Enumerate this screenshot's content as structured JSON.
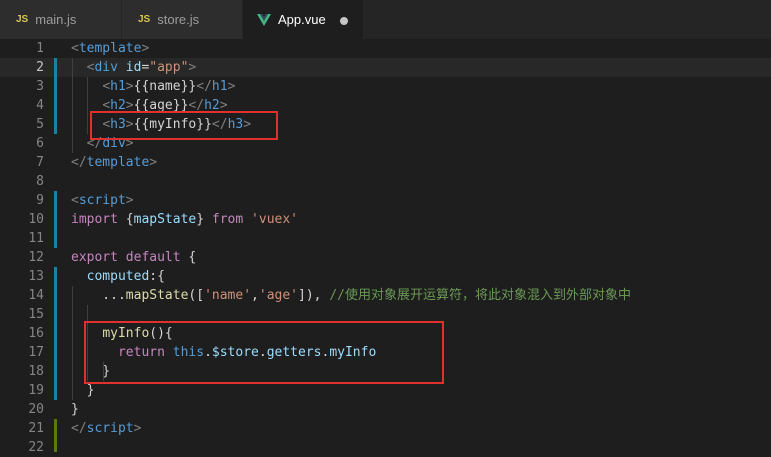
{
  "tabs": [
    {
      "label": "main.js",
      "icon": "JS"
    },
    {
      "label": "store.js",
      "icon": "JS"
    },
    {
      "label": "App.vue",
      "icon": "vue"
    }
  ],
  "lines": [
    {
      "n": "1",
      "tokens": [
        [
          "punc",
          "<"
        ],
        [
          "tag",
          "template"
        ],
        [
          "punc",
          ">"
        ]
      ]
    },
    {
      "n": "2",
      "tokens": [
        [
          "text",
          "  "
        ],
        [
          "punc",
          "<"
        ],
        [
          "tag",
          "div"
        ],
        [
          "text",
          " "
        ],
        [
          "attr",
          "id"
        ],
        [
          "text",
          "="
        ],
        [
          "str",
          "\"app\""
        ],
        [
          "punc",
          ">"
        ]
      ]
    },
    {
      "n": "3",
      "tokens": [
        [
          "text",
          "    "
        ],
        [
          "punc",
          "<"
        ],
        [
          "tag",
          "h1"
        ],
        [
          "punc",
          ">"
        ],
        [
          "text",
          "{{name}}"
        ],
        [
          "punc",
          "</"
        ],
        [
          "tag",
          "h1"
        ],
        [
          "punc",
          ">"
        ]
      ]
    },
    {
      "n": "4",
      "tokens": [
        [
          "text",
          "    "
        ],
        [
          "punc",
          "<"
        ],
        [
          "tag",
          "h2"
        ],
        [
          "punc",
          ">"
        ],
        [
          "text",
          "{{age}}"
        ],
        [
          "punc",
          "</"
        ],
        [
          "tag",
          "h2"
        ],
        [
          "punc",
          ">"
        ]
      ]
    },
    {
      "n": "5",
      "tokens": [
        [
          "text",
          "    "
        ],
        [
          "punc",
          "<"
        ],
        [
          "tag",
          "h3"
        ],
        [
          "punc",
          ">"
        ],
        [
          "text",
          "{{myInfo}}"
        ],
        [
          "punc",
          "</"
        ],
        [
          "tag",
          "h3"
        ],
        [
          "punc",
          ">"
        ]
      ]
    },
    {
      "n": "6",
      "tokens": [
        [
          "text",
          "  "
        ],
        [
          "punc",
          "</"
        ],
        [
          "tag",
          "div"
        ],
        [
          "punc",
          ">"
        ]
      ]
    },
    {
      "n": "7",
      "tokens": [
        [
          "punc",
          "</"
        ],
        [
          "tag",
          "template"
        ],
        [
          "punc",
          ">"
        ]
      ]
    },
    {
      "n": "8",
      "tokens": []
    },
    {
      "n": "9",
      "tokens": [
        [
          "punc",
          "<"
        ],
        [
          "tag",
          "script"
        ],
        [
          "punc",
          ">"
        ]
      ]
    },
    {
      "n": "10",
      "tokens": [
        [
          "kw",
          "import"
        ],
        [
          "text",
          " {"
        ],
        [
          "var",
          "mapState"
        ],
        [
          "text",
          "} "
        ],
        [
          "kw",
          "from"
        ],
        [
          "text",
          " "
        ],
        [
          "str",
          "'vuex'"
        ]
      ]
    },
    {
      "n": "11",
      "tokens": []
    },
    {
      "n": "12",
      "tokens": [
        [
          "kw",
          "export"
        ],
        [
          "text",
          " "
        ],
        [
          "kw",
          "default"
        ],
        [
          "text",
          " {"
        ]
      ]
    },
    {
      "n": "13",
      "tokens": [
        [
          "text",
          "  "
        ],
        [
          "var",
          "computed"
        ],
        [
          "text",
          ":{"
        ]
      ]
    },
    {
      "n": "14",
      "tokens": [
        [
          "text",
          "    ..."
        ],
        [
          "fn",
          "mapState"
        ],
        [
          "text",
          "(["
        ],
        [
          "str",
          "'name'"
        ],
        [
          "text",
          ","
        ],
        [
          "str",
          "'age'"
        ],
        [
          "text",
          "]), "
        ],
        [
          "cmt",
          "//使用对象展开运算符，将此对象混入到外部对象中"
        ]
      ]
    },
    {
      "n": "15",
      "tokens": []
    },
    {
      "n": "16",
      "tokens": [
        [
          "text",
          "    "
        ],
        [
          "fn",
          "myInfo"
        ],
        [
          "text",
          "(){"
        ]
      ]
    },
    {
      "n": "17",
      "tokens": [
        [
          "text",
          "      "
        ],
        [
          "kw",
          "return"
        ],
        [
          "text",
          " "
        ],
        [
          "blue",
          "this"
        ],
        [
          "text",
          "."
        ],
        [
          "var",
          "$store"
        ],
        [
          "text",
          "."
        ],
        [
          "var",
          "getters"
        ],
        [
          "text",
          "."
        ],
        [
          "var",
          "myInfo"
        ]
      ]
    },
    {
      "n": "18",
      "tokens": [
        [
          "text",
          "    }"
        ]
      ]
    },
    {
      "n": "19",
      "tokens": [
        [
          "text",
          "  }"
        ]
      ]
    },
    {
      "n": "20",
      "tokens": [
        [
          "text",
          "}"
        ]
      ]
    },
    {
      "n": "21",
      "tokens": [
        [
          "punc",
          "</"
        ],
        [
          "tag",
          "script"
        ],
        [
          "punc",
          ">"
        ]
      ]
    },
    {
      "n": "22",
      "tokens": []
    }
  ],
  "colors": {
    "editor_bg": "#1e1e1e",
    "highlight_box": "#e0312f",
    "git_modified": "#1b81a8",
    "git_added": "#587c0c"
  }
}
